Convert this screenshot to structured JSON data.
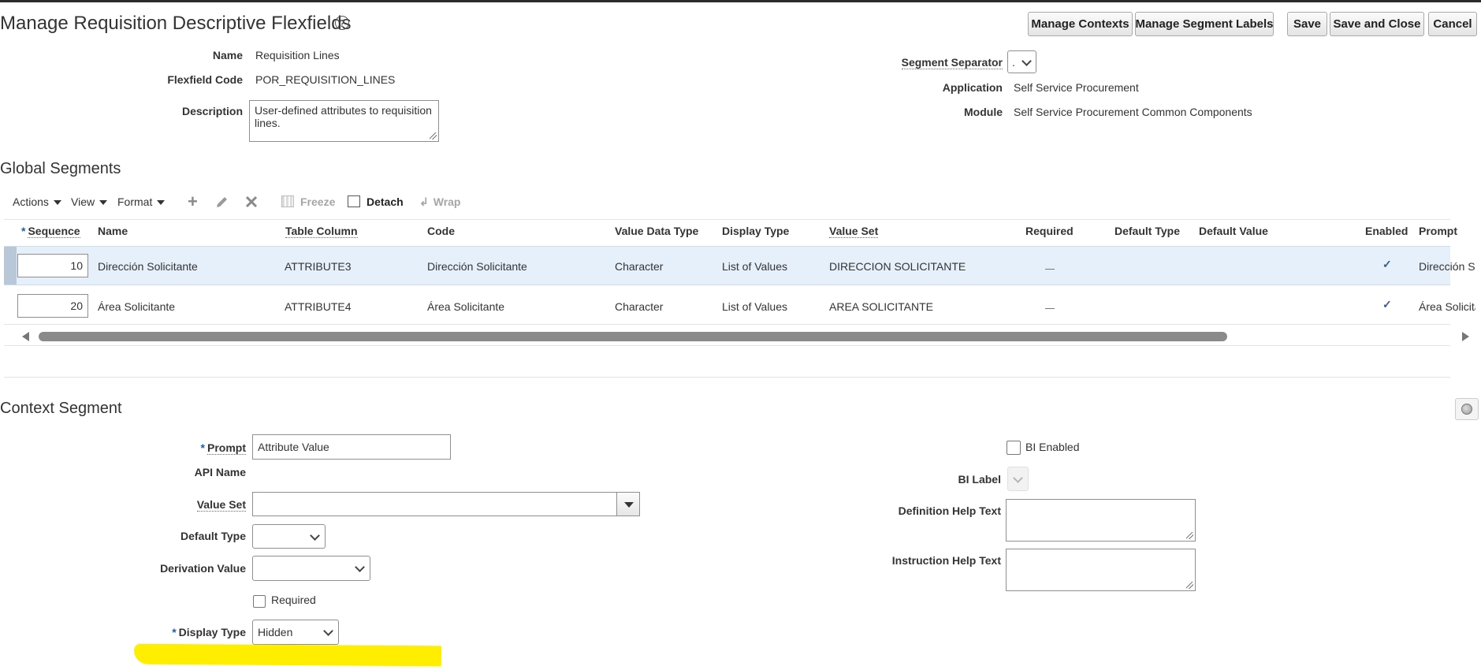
{
  "header": {
    "title": "Manage Requisition Descriptive Flexfields",
    "help_glyph": "?",
    "buttons": {
      "manage_contexts": "Manage Contexts",
      "manage_segment_labels": "Manage Segment Labels",
      "save": "Save",
      "save_and_close": "Save and Close",
      "cancel": "Cancel"
    }
  },
  "details": {
    "name_label": "Name",
    "name_value": "Requisition Lines",
    "code_label": "Flexfield Code",
    "code_value": "POR_REQUISITION_LINES",
    "description_label": "Description",
    "description_value": "User-defined attributes to requisition lines.",
    "separator_label": "Segment Separator",
    "separator_value": ".",
    "application_label": "Application",
    "application_value": "Self Service Procurement",
    "module_label": "Module",
    "module_value": "Self Service Procurement Common Components"
  },
  "global_segments": {
    "title": "Global Segments",
    "toolbar": {
      "actions": "Actions",
      "view": "View",
      "format": "Format",
      "freeze": "Freeze",
      "detach": "Detach",
      "wrap": "Wrap"
    },
    "columns": {
      "sequence": "Sequence",
      "name": "Name",
      "table_column": "Table Column",
      "code": "Code",
      "value_data_type": "Value Data Type",
      "display_type": "Display Type",
      "value_set": "Value Set",
      "required": "Required",
      "default_type": "Default Type",
      "default_value": "Default Value",
      "enabled": "Enabled",
      "prompt": "Prompt"
    },
    "rows": [
      {
        "sequence": "10",
        "name": "Dirección Solicitante",
        "table_column": "ATTRIBUTE3",
        "code": "Dirección Solicitante",
        "value_data_type": "Character",
        "display_type": "List of Values",
        "value_set": "DIRECCION SOLICITANTE",
        "enabled": "✓",
        "prompt": "Dirección Solicitante",
        "selected": true
      },
      {
        "sequence": "20",
        "name": "Área Solicitante",
        "table_column": "ATTRIBUTE4",
        "code": "Área Solicitante",
        "value_data_type": "Character",
        "display_type": "List of Values",
        "value_set": "AREA SOLICITANTE",
        "enabled": "✓",
        "prompt": "Área Solicitante",
        "selected": false
      }
    ]
  },
  "context_segment": {
    "title": "Context Segment",
    "prompt_label": "Prompt",
    "prompt_value": "Attribute Value",
    "api_name_label": "API Name",
    "value_set_label": "Value Set",
    "value_set_value": "",
    "default_type_label": "Default Type",
    "default_type_value": "",
    "derivation_value_label": "Derivation Value",
    "derivation_value_value": "",
    "required_label": "Required",
    "display_type_label": "Display Type",
    "display_type_value": "Hidden",
    "bi_enabled_label": "BI Enabled",
    "bi_label_label": "BI Label",
    "definition_help_label": "Definition Help Text",
    "instruction_help_label": "Instruction Help Text"
  },
  "colors": {
    "selected_row": "#e6f0fa",
    "required_marker": "#1a5fa8",
    "highlight": "#ffee00"
  }
}
